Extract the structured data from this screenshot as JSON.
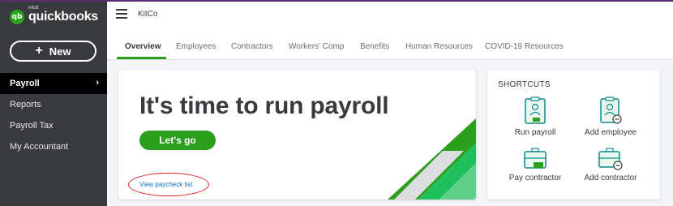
{
  "brand": {
    "logo_text": "qb",
    "intuit": "intuit",
    "name": "quickbooks"
  },
  "sidebar": {
    "new_label": "New",
    "items": [
      {
        "label": "Payroll",
        "active": true
      },
      {
        "label": "Reports"
      },
      {
        "label": "Payroll Tax"
      },
      {
        "label": "My Accountant"
      }
    ]
  },
  "header": {
    "company": "KitCo"
  },
  "tabs": [
    {
      "label": "Overview",
      "active": true
    },
    {
      "label": "Employees"
    },
    {
      "label": "Contractors"
    },
    {
      "label": "Workers' Comp"
    },
    {
      "label": "Benefits"
    },
    {
      "label": "Human Resources"
    },
    {
      "label": "COVID-19 Resources"
    }
  ],
  "main": {
    "title": "It's time to run payroll",
    "cta_label": "Let's go",
    "link_label": "View paycheck list"
  },
  "shortcuts": {
    "title": "SHORTCUTS",
    "items": [
      {
        "label": "Run payroll",
        "icon": "run-payroll-icon"
      },
      {
        "label": "Add employee",
        "icon": "add-employee-icon"
      },
      {
        "label": "Pay contractor",
        "icon": "pay-contractor-icon"
      },
      {
        "label": "Add contractor",
        "icon": "add-contractor-icon"
      }
    ]
  },
  "colors": {
    "brand_green": "#2ca01c",
    "sidebar_bg": "#393a3d",
    "link_blue": "#0077c5",
    "annotation_red": "#e02020"
  }
}
